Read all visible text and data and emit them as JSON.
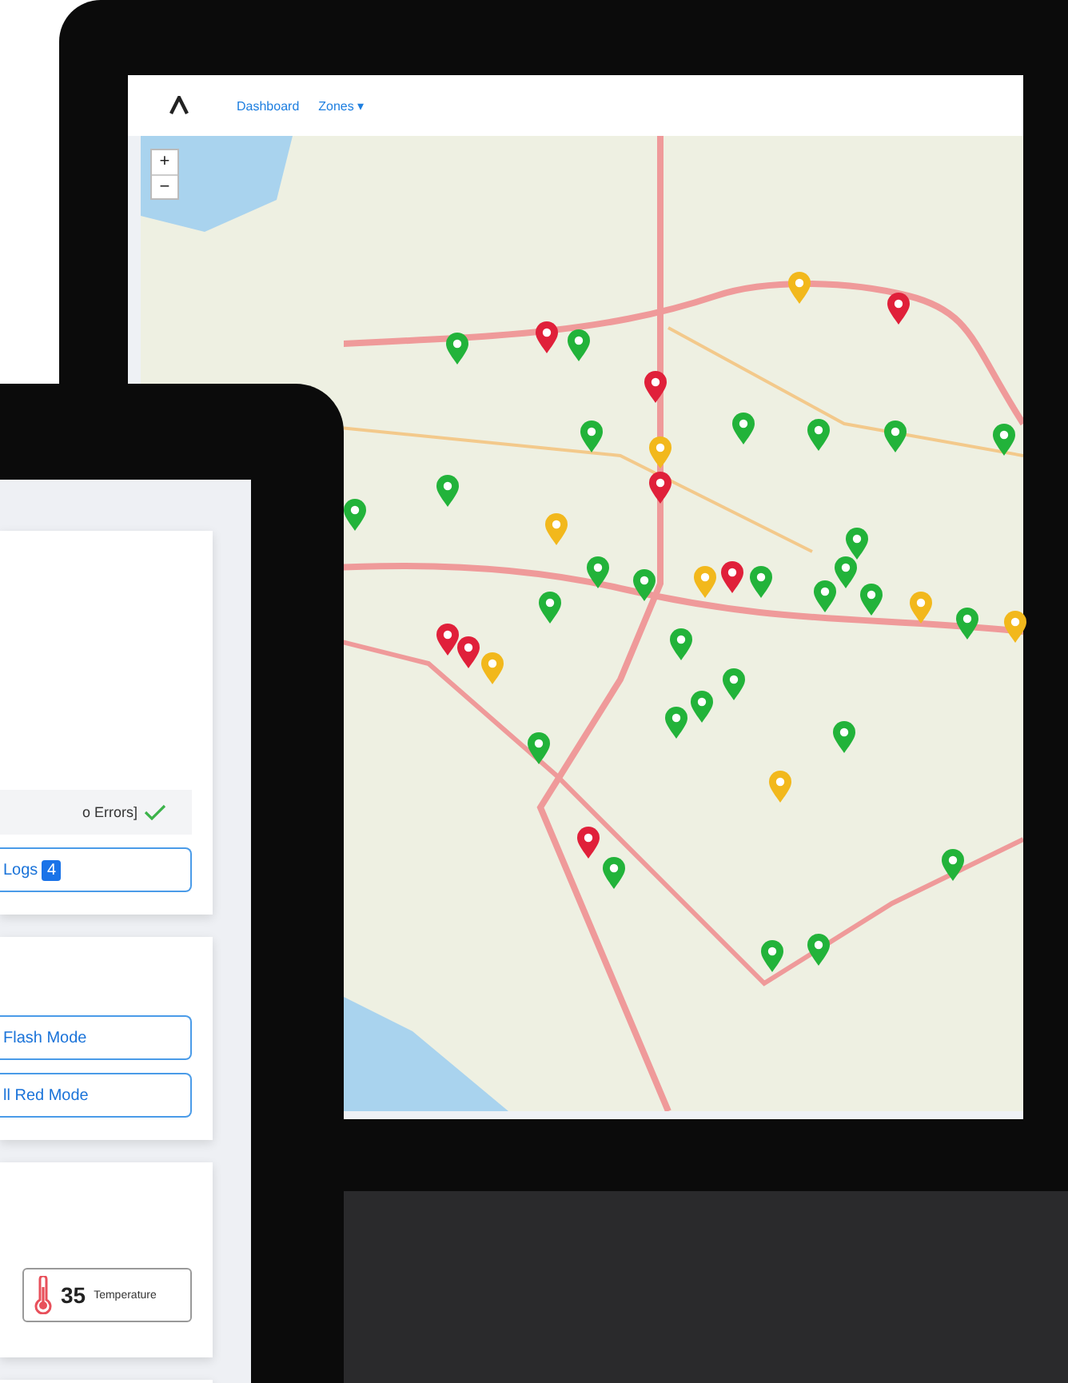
{
  "monitor": {
    "nav": {
      "links": [
        {
          "label": "Dashboard"
        },
        {
          "label": "Zones ▾"
        }
      ]
    },
    "map": {
      "zoom_in": "+",
      "zoom_out": "−",
      "pins": [
        {
          "color": "#f2b81c"
        },
        {
          "color": "#e0203a"
        },
        {
          "color": "#22b33a"
        },
        {
          "color": "#e0203a"
        },
        {
          "color": "#22b33a"
        },
        {
          "color": "#e0203a"
        },
        {
          "color": "#22b33a"
        },
        {
          "color": "#f2b81c"
        },
        {
          "color": "#22b33a"
        },
        {
          "color": "#22b33a"
        },
        {
          "color": "#22b33a"
        },
        {
          "color": "#22b33a"
        },
        {
          "color": "#e0203a"
        },
        {
          "color": "#22b33a"
        },
        {
          "color": "#22b33a"
        },
        {
          "color": "#f2b81c"
        },
        {
          "color": "#22b33a"
        },
        {
          "color": "#22b33a"
        },
        {
          "color": "#22b33a"
        },
        {
          "color": "#f2b81c"
        },
        {
          "color": "#e0203a"
        },
        {
          "color": "#22b33a"
        },
        {
          "color": "#22b33a"
        },
        {
          "color": "#22b33a"
        },
        {
          "color": "#22b33a"
        },
        {
          "color": "#f2b81c"
        },
        {
          "color": "#22b33a"
        },
        {
          "color": "#f2b81c"
        },
        {
          "color": "#22b33a"
        },
        {
          "color": "#e0203a"
        },
        {
          "color": "#e0203a"
        },
        {
          "color": "#f2b81c"
        },
        {
          "color": "#22b33a"
        },
        {
          "color": "#22b33a"
        },
        {
          "color": "#22b33a"
        },
        {
          "color": "#22b33a"
        },
        {
          "color": "#22b33a"
        },
        {
          "color": "#22b33a"
        },
        {
          "color": "#f2b81c"
        },
        {
          "color": "#e0203a"
        },
        {
          "color": "#22b33a"
        },
        {
          "color": "#22b33a"
        },
        {
          "color": "#22b33a"
        },
        {
          "color": "#22b33a"
        }
      ]
    }
  },
  "tablet": {
    "status_card": {
      "status": "o Errors]",
      "logs_button": {
        "label": "Logs",
        "badge": "4"
      }
    },
    "mode_card": {
      "buttons": [
        "Flash Mode",
        "ll Red Mode"
      ]
    },
    "sensor_card": {
      "value": "35",
      "label": "Temperature"
    }
  }
}
